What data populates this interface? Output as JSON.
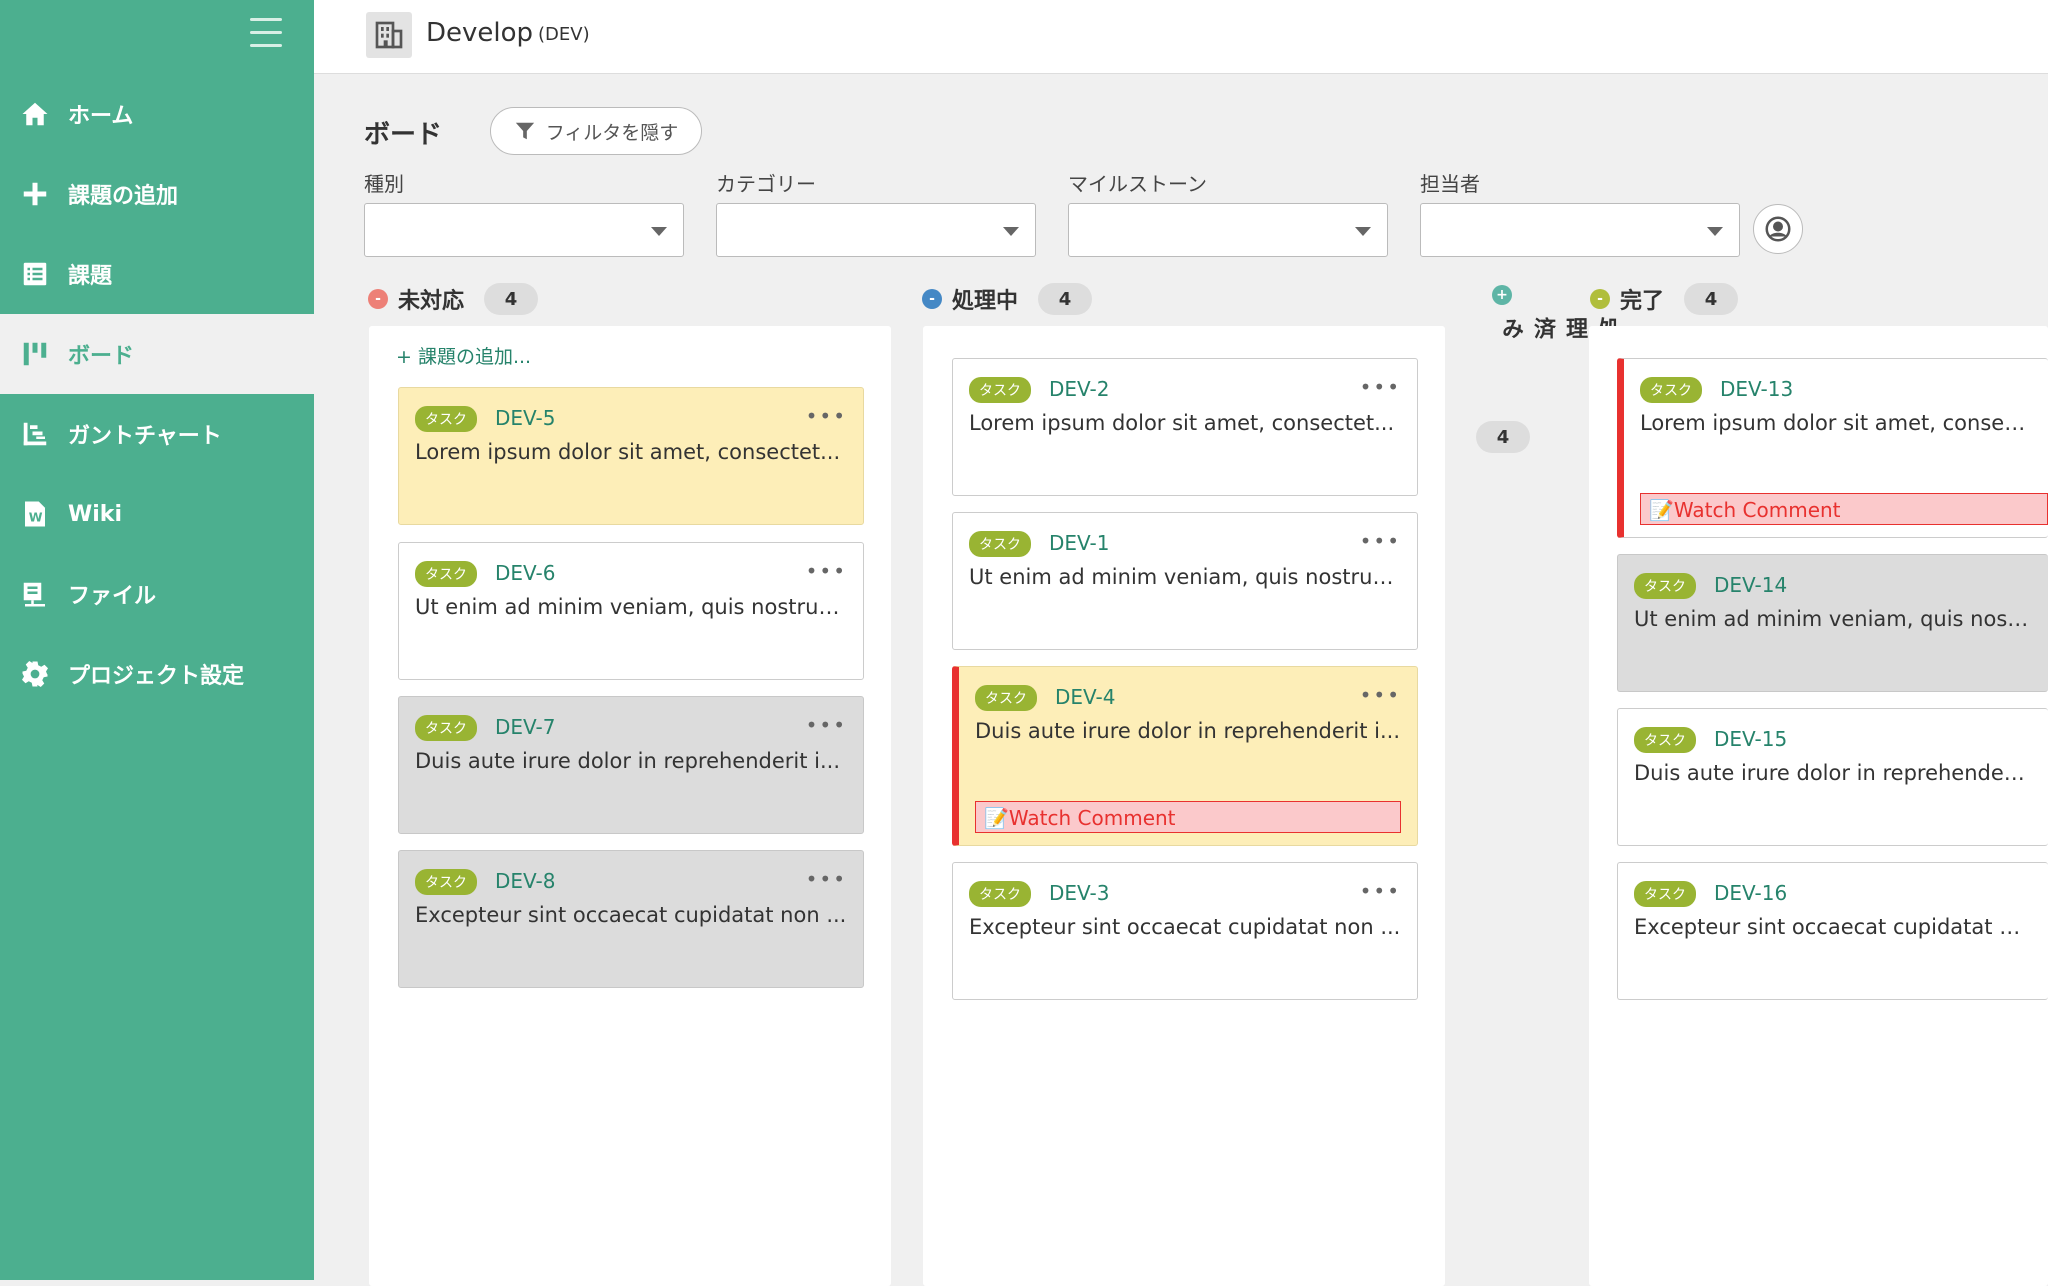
{
  "sidebar": {
    "items": [
      {
        "label": "ホーム",
        "icon": "home-icon"
      },
      {
        "label": "課題の追加",
        "icon": "plus-icon"
      },
      {
        "label": "課題",
        "icon": "list-icon"
      },
      {
        "label": "ボード",
        "icon": "board-icon",
        "active": true
      },
      {
        "label": "ガントチャート",
        "icon": "gantt-icon"
      },
      {
        "label": "Wiki",
        "icon": "wiki-icon"
      },
      {
        "label": "ファイル",
        "icon": "file-icon"
      },
      {
        "label": "プロジェクト設定",
        "icon": "gear-icon"
      }
    ]
  },
  "header": {
    "project_name": "Develop",
    "project_key": "(DEV)"
  },
  "board": {
    "title": "ボード",
    "filter_toggle": "フィルタを隠す",
    "filters": [
      {
        "label": "種別",
        "value": ""
      },
      {
        "label": "カテゴリー",
        "value": ""
      },
      {
        "label": "マイルストーン",
        "value": ""
      },
      {
        "label": "担当者",
        "value": ""
      }
    ],
    "add_issue": "課題の追加..."
  },
  "columns": [
    {
      "title": "未対応",
      "count": "4",
      "color": "#ed8077",
      "symbol": "-",
      "cards": [
        {
          "tag": "タスク",
          "key": "DEV-5",
          "summary": "Lorem ipsum dolor sit amet, consectet...",
          "style": "yellow"
        },
        {
          "tag": "タスク",
          "key": "DEV-6",
          "summary": "Ut enim ad minim veniam, quis nostrud...",
          "style": "white"
        },
        {
          "tag": "タスク",
          "key": "DEV-7",
          "summary": "Duis aute irure dolor in reprehenderit i...",
          "style": "gray"
        },
        {
          "tag": "タスク",
          "key": "DEV-8",
          "summary": "Excepteur sint occaecat cupidatat non ...",
          "style": "gray"
        }
      ]
    },
    {
      "title": "処理中",
      "count": "4",
      "color": "#4488c5",
      "symbol": "-",
      "cards": [
        {
          "tag": "タスク",
          "key": "DEV-2",
          "summary": "Lorem ipsum dolor sit amet, consectet...",
          "style": "white"
        },
        {
          "tag": "タスク",
          "key": "DEV-1",
          "summary": "Ut enim ad minim veniam, quis nostrud...",
          "style": "white"
        },
        {
          "tag": "タスク",
          "key": "DEV-4",
          "summary": "Duis aute irure dolor in reprehenderit i...",
          "style": "yellow",
          "watch": "📝Watch Comment"
        },
        {
          "tag": "タスク",
          "key": "DEV-3",
          "summary": "Excepteur sint occaecat cupidatat non ...",
          "style": "white"
        }
      ]
    },
    {
      "title": "処理済み",
      "count": "4",
      "color": "#5eb5a6",
      "symbol": "+",
      "collapsed": true
    },
    {
      "title": "完了",
      "count": "4",
      "color": "#b0be3c",
      "symbol": "-",
      "cards": [
        {
          "tag": "タスク",
          "key": "DEV-13",
          "summary": "Lorem ipsum dolor sit amet, consectet...",
          "style": "white",
          "watch": "📝Watch Comment"
        },
        {
          "tag": "タスク",
          "key": "DEV-14",
          "summary": "Ut enim ad minim veniam, quis nostrud...",
          "style": "gray"
        },
        {
          "tag": "タスク",
          "key": "DEV-15",
          "summary": "Duis aute irure dolor in reprehenderit i...",
          "style": "white"
        },
        {
          "tag": "タスク",
          "key": "DEV-16",
          "summary": "Excepteur sint occaecat cupidatat non ...",
          "style": "white"
        }
      ]
    }
  ]
}
